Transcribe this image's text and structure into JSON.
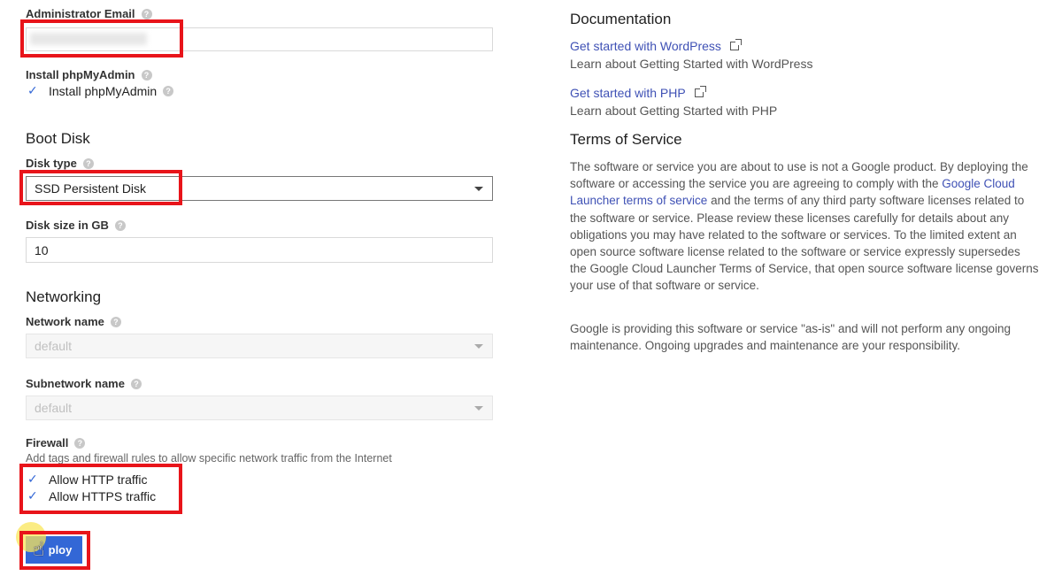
{
  "form": {
    "admin_email": {
      "label": "Administrator Email",
      "value": ""
    },
    "phpmyadmin": {
      "label": "Install phpMyAdmin",
      "checkbox_label": "Install phpMyAdmin",
      "checked": true
    },
    "boot_disk": {
      "title": "Boot Disk",
      "disk_type": {
        "label": "Disk type",
        "value": "SSD Persistent Disk"
      },
      "disk_size": {
        "label": "Disk size in GB",
        "value": "10"
      }
    },
    "networking": {
      "title": "Networking",
      "network_name": {
        "label": "Network name",
        "value": "default"
      },
      "subnetwork_name": {
        "label": "Subnetwork name",
        "value": "default"
      }
    },
    "firewall": {
      "label": "Firewall",
      "hint": "Add tags and firewall rules to allow specific network traffic from the Internet",
      "http": {
        "label": "Allow HTTP traffic",
        "checked": true
      },
      "https": {
        "label": "Allow HTTPS traffic",
        "checked": true
      }
    },
    "deploy_label": "ploy",
    "help_glyph": "?",
    "check_glyph": "✓"
  },
  "documentation": {
    "title": "Documentation",
    "links": [
      {
        "label": "Get started with WordPress",
        "desc": "Learn about Getting Started with WordPress"
      },
      {
        "label": "Get started with PHP",
        "desc": "Learn about Getting Started with PHP"
      }
    ]
  },
  "terms": {
    "title": "Terms of Service",
    "p1_before": "The software or service you are about to use is not a Google product. By deploying the software or accessing the service you are agreeing to comply with the ",
    "p1_link": "Google Cloud Launcher terms of service",
    "p1_after": " and the terms of any third party software licenses related to the software or service. Please review these licenses carefully for details about any obligations you may have related to the software or services. To the limited extent an open source software license related to the software or service expressly supersedes the Google Cloud Launcher Terms of Service, that open source software license governs your use of that software or service.",
    "p2": "Google is providing this software or service \"as-is\" and will not perform any ongoing maintenance. Ongoing upgrades and maintenance are your responsibility."
  },
  "colors": {
    "highlight": "#e8141a",
    "accent": "#3367d6",
    "link": "#3f51b5"
  }
}
